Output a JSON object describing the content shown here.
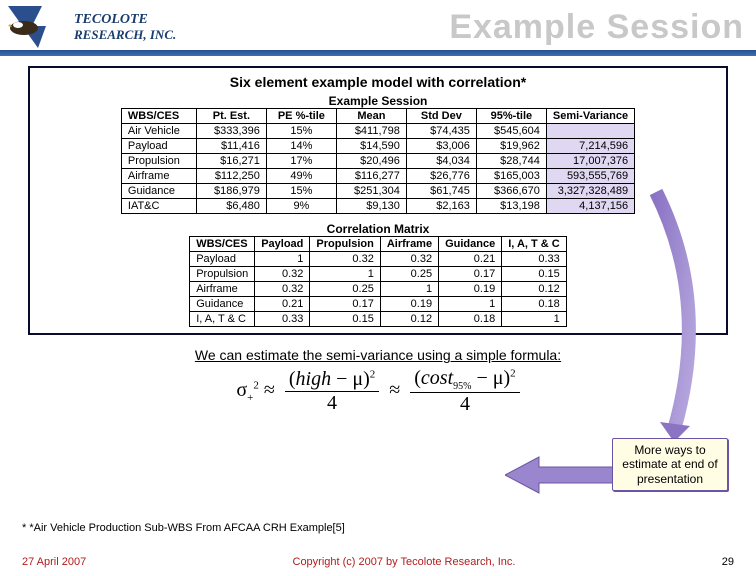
{
  "header": {
    "company1": "TECOLOTE",
    "company2": "RESEARCH, INC.",
    "title": "Example Session"
  },
  "caption": "Six element example model with correlation*",
  "table1": {
    "title": "Example Session",
    "headers": [
      "WBS/CES",
      "Pt. Est.",
      "PE %-tile",
      "Mean",
      "Std Dev",
      "95%-tile",
      "Semi-Variance"
    ],
    "rows": [
      [
        "Air Vehicle",
        "$333,396",
        "15%",
        "$411,798",
        "$74,435",
        "$545,604",
        ""
      ],
      [
        "Payload",
        "$11,416",
        "14%",
        "$14,590",
        "$3,006",
        "$19,962",
        "7,214,596"
      ],
      [
        "Propulsion",
        "$16,271",
        "17%",
        "$20,496",
        "$4,034",
        "$28,744",
        "17,007,376"
      ],
      [
        "Airframe",
        "$112,250",
        "49%",
        "$116,277",
        "$26,776",
        "$165,003",
        "593,555,769"
      ],
      [
        "Guidance",
        "$186,979",
        "15%",
        "$251,304",
        "$61,745",
        "$366,670",
        "3,327,328,489"
      ],
      [
        "IAT&C",
        "$6,480",
        "9%",
        "$9,130",
        "$2,163",
        "$13,198",
        "4,137,156"
      ]
    ]
  },
  "table2": {
    "title": "Correlation Matrix",
    "headers": [
      "WBS/CES",
      "Payload",
      "Propulsion",
      "Airframe",
      "Guidance",
      "I, A, T & C"
    ],
    "rows": [
      [
        "Payload",
        "1",
        "0.32",
        "0.32",
        "0.21",
        "0.33"
      ],
      [
        "Propulsion",
        "0.32",
        "1",
        "0.25",
        "0.17",
        "0.15"
      ],
      [
        "Airframe",
        "0.32",
        "0.25",
        "1",
        "0.19",
        "0.12"
      ],
      [
        "Guidance",
        "0.21",
        "0.17",
        "0.19",
        "1",
        "0.18"
      ],
      [
        "I, A, T & C",
        "0.33",
        "0.15",
        "0.12",
        "0.18",
        "1"
      ]
    ]
  },
  "formula_caption": "We can estimate the semi-variance using a simple formula:",
  "callout": "More ways to estimate at end of presentation",
  "footnote": "* *Air Vehicle Production Sub-WBS From AFCAA CRH Example[5]",
  "footer": {
    "date": "27 April 2007",
    "copy": "Copyright (c) 2007 by Tecolote Research, Inc.",
    "page": "29"
  },
  "chart_data": [
    {
      "type": "table",
      "title": "Example Session",
      "columns": [
        "WBS/CES",
        "Pt. Est.",
        "PE %-tile",
        "Mean",
        "Std Dev",
        "95%-tile",
        "Semi-Variance"
      ],
      "rows": [
        {
          "WBS/CES": "Air Vehicle",
          "Pt. Est.": 333396,
          "PE %-tile": 15,
          "Mean": 411798,
          "Std Dev": 74435,
          "95%-tile": 545604,
          "Semi-Variance": null
        },
        {
          "WBS/CES": "Payload",
          "Pt. Est.": 11416,
          "PE %-tile": 14,
          "Mean": 14590,
          "Std Dev": 3006,
          "95%-tile": 19962,
          "Semi-Variance": 7214596
        },
        {
          "WBS/CES": "Propulsion",
          "Pt. Est.": 16271,
          "PE %-tile": 17,
          "Mean": 20496,
          "Std Dev": 4034,
          "95%-tile": 28744,
          "Semi-Variance": 17007376
        },
        {
          "WBS/CES": "Airframe",
          "Pt. Est.": 112250,
          "PE %-tile": 49,
          "Mean": 116277,
          "Std Dev": 26776,
          "95%-tile": 165003,
          "Semi-Variance": 593555769
        },
        {
          "WBS/CES": "Guidance",
          "Pt. Est.": 186979,
          "PE %-tile": 15,
          "Mean": 251304,
          "Std Dev": 61745,
          "95%-tile": 366670,
          "Semi-Variance": 3327328489
        },
        {
          "WBS/CES": "IAT&C",
          "Pt. Est.": 6480,
          "PE %-tile": 9,
          "Mean": 9130,
          "Std Dev": 2163,
          "95%-tile": 13198,
          "Semi-Variance": 4137156
        }
      ]
    },
    {
      "type": "table",
      "title": "Correlation Matrix",
      "columns": [
        "WBS/CES",
        "Payload",
        "Propulsion",
        "Airframe",
        "Guidance",
        "I, A, T & C"
      ],
      "rows": [
        {
          "WBS/CES": "Payload",
          "Payload": 1,
          "Propulsion": 0.32,
          "Airframe": 0.32,
          "Guidance": 0.21,
          "I, A, T & C": 0.33
        },
        {
          "WBS/CES": "Propulsion",
          "Payload": 0.32,
          "Propulsion": 1,
          "Airframe": 0.25,
          "Guidance": 0.17,
          "I, A, T & C": 0.15
        },
        {
          "WBS/CES": "Airframe",
          "Payload": 0.32,
          "Propulsion": 0.25,
          "Airframe": 1,
          "Guidance": 0.19,
          "I, A, T & C": 0.12
        },
        {
          "WBS/CES": "Guidance",
          "Payload": 0.21,
          "Propulsion": 0.17,
          "Airframe": 0.19,
          "Guidance": 1,
          "I, A, T & C": 0.18
        },
        {
          "WBS/CES": "I, A, T & C",
          "Payload": 0.33,
          "Propulsion": 0.15,
          "Airframe": 0.12,
          "Guidance": 0.18,
          "I, A, T & C": 1
        }
      ]
    }
  ]
}
